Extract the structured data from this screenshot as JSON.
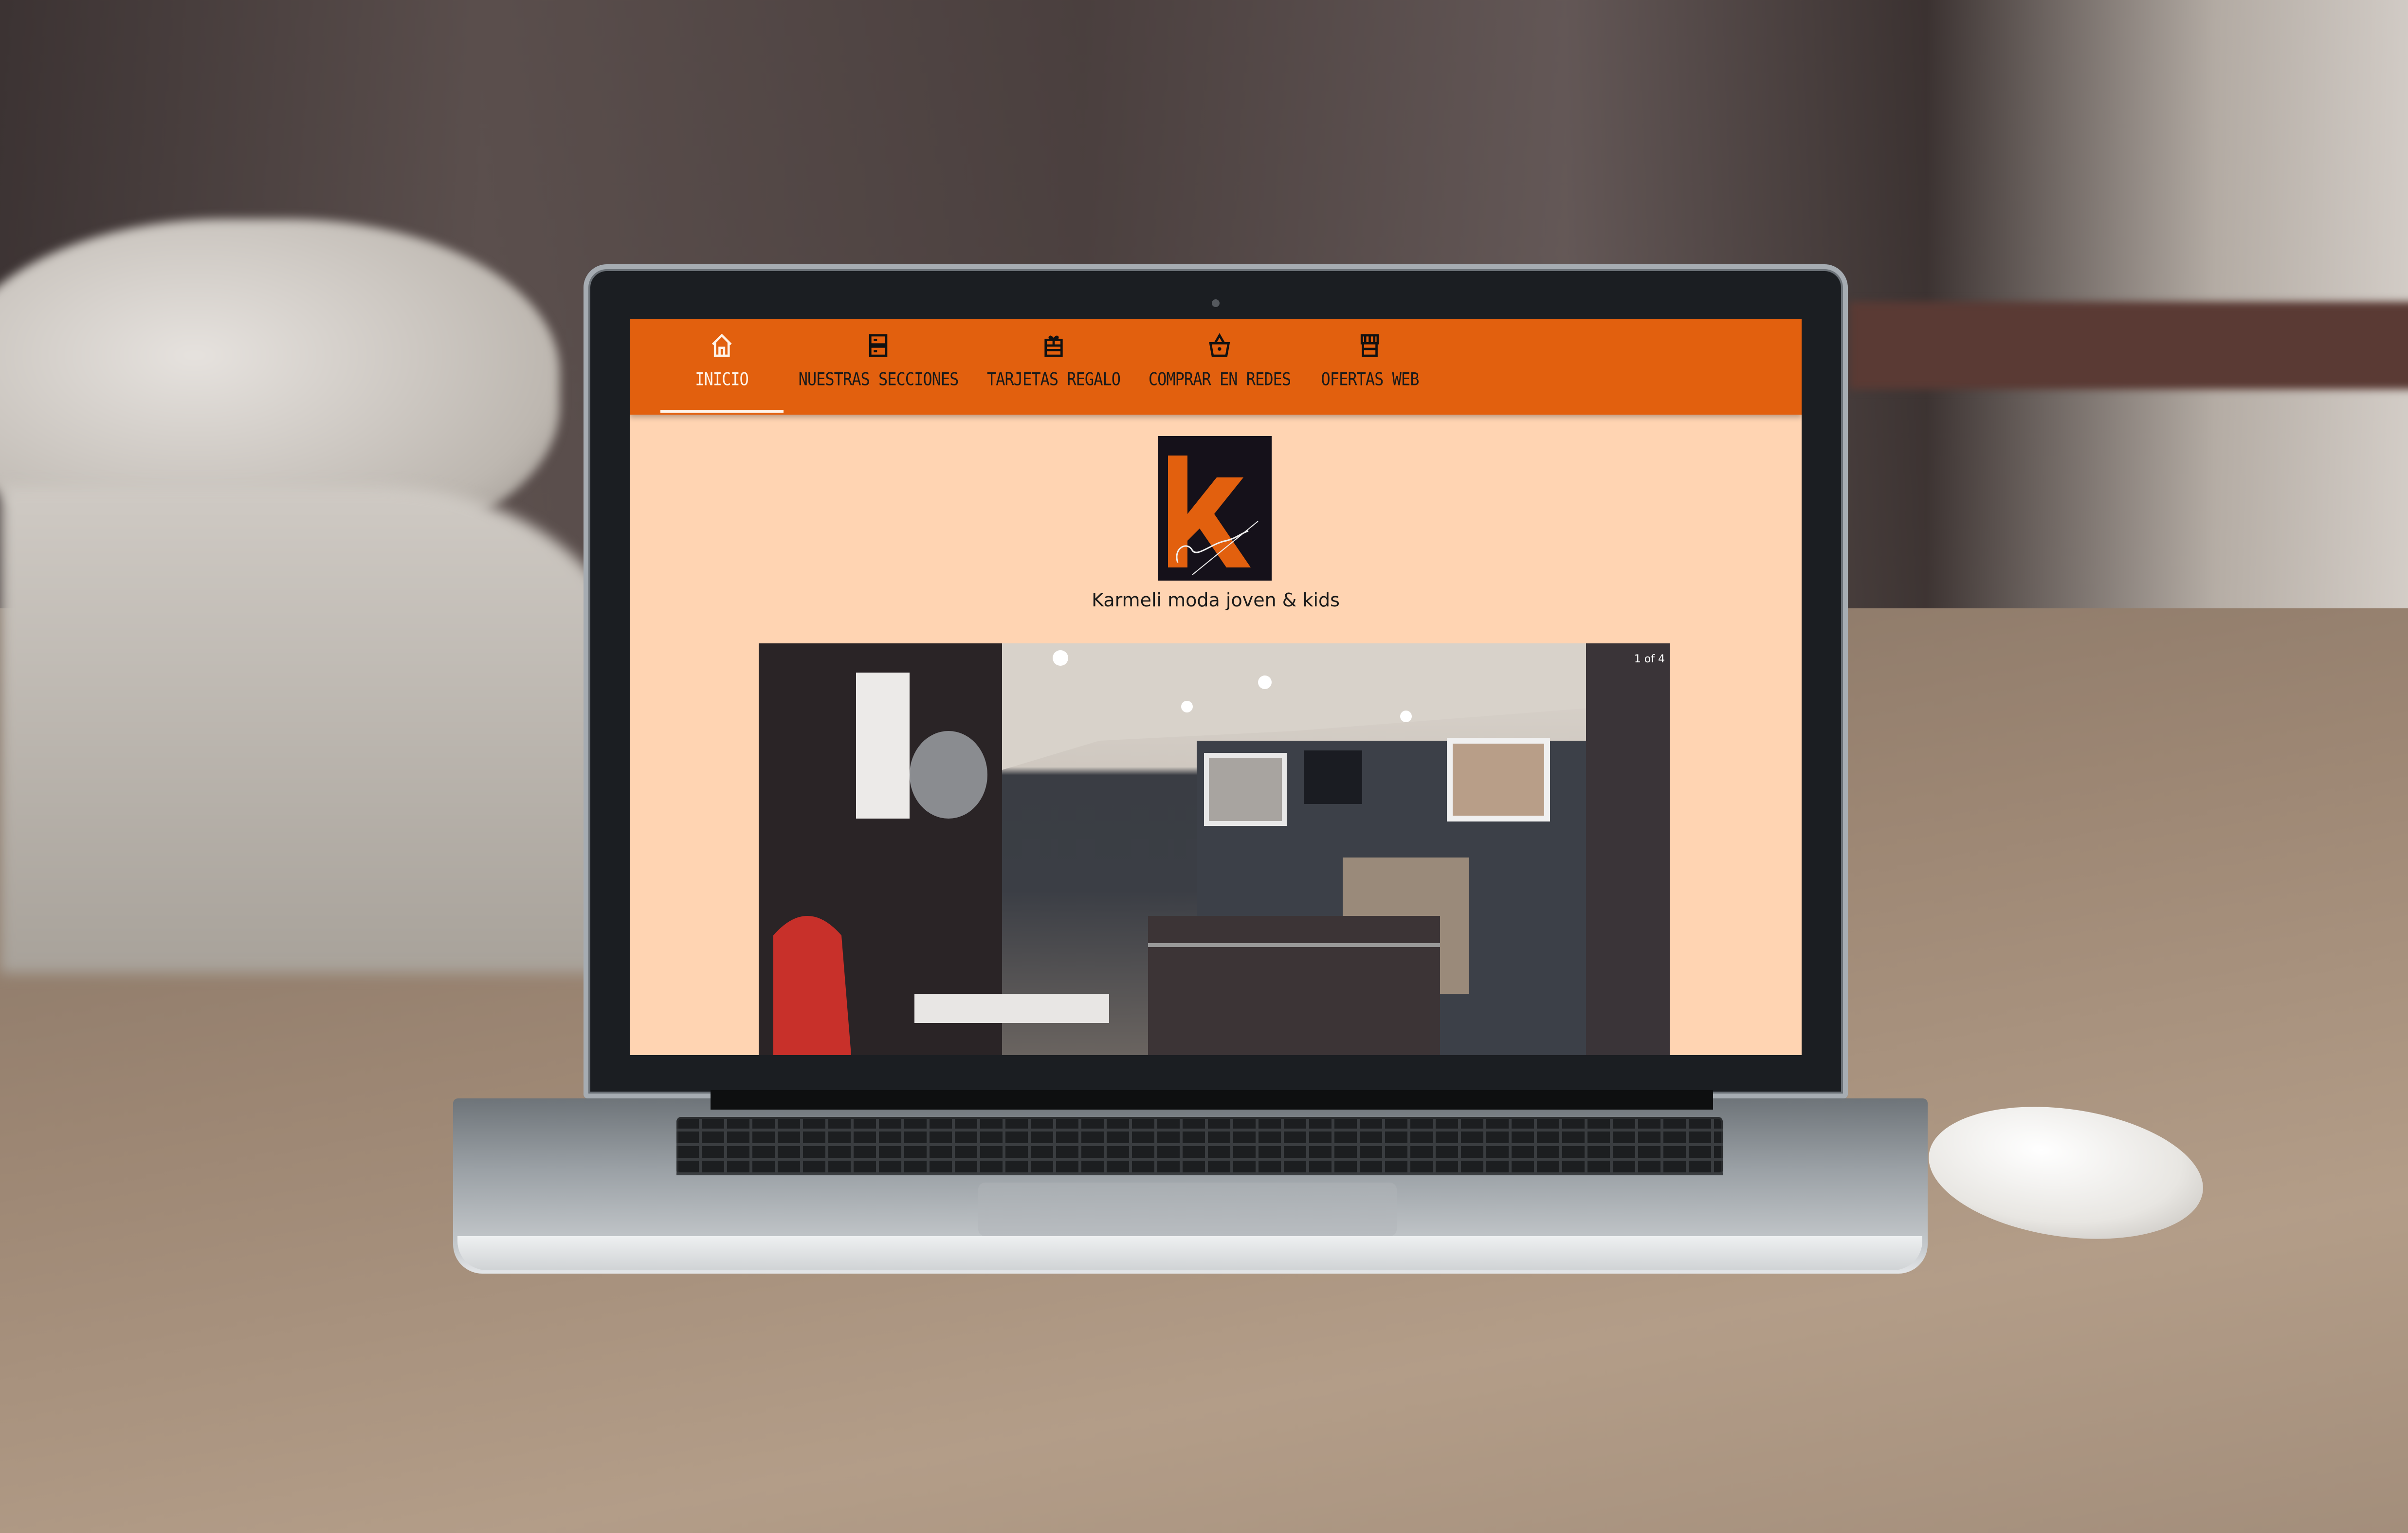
{
  "nav": {
    "accent_color": "#e2600e",
    "items": [
      {
        "label": "INICIO",
        "icon": "home-icon",
        "active": true
      },
      {
        "label": "NUESTRAS SECCIONES",
        "icon": "sections-icon",
        "active": false
      },
      {
        "label": "TARJETAS REGALO",
        "icon": "gift-icon",
        "active": false
      },
      {
        "label": "COMPRAR EN REDES",
        "icon": "basket-icon",
        "active": false
      },
      {
        "label": "OFERTAS WEB",
        "icon": "store-icon",
        "active": false
      }
    ]
  },
  "brand": {
    "logo_letter": "k",
    "logo_signature": "Karmeli",
    "tagline": "Karmeli moda joven & kids"
  },
  "slideshow": {
    "counter": "1 of 4"
  },
  "page_background": "#ffd4b2"
}
